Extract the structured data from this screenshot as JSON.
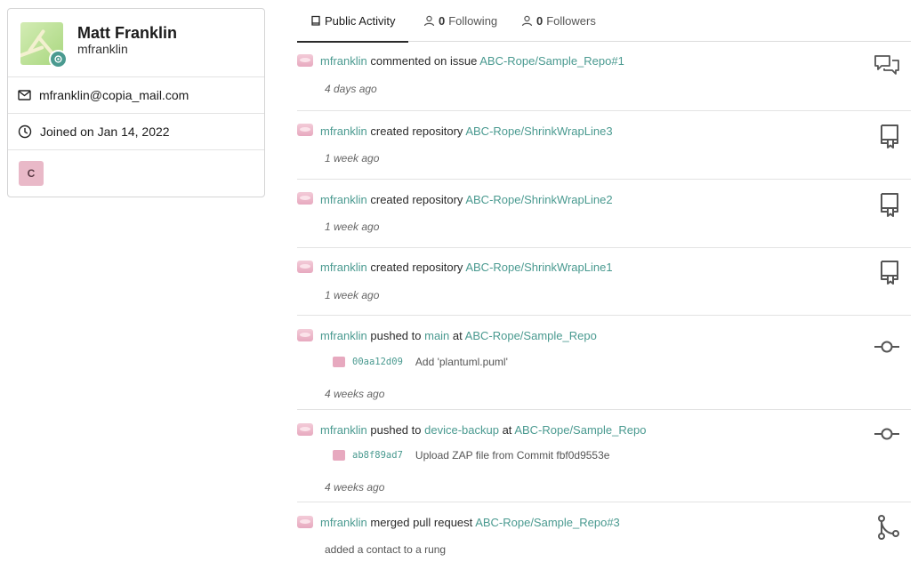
{
  "profile": {
    "full_name": "Matt Franklin",
    "username": "mfranklin",
    "email": "mfranklin@copia_mail.com",
    "joined": "Joined on Jan 14, 2022",
    "org_initial": "C",
    "icons": {
      "badge": "gear-icon",
      "email": "mail-icon",
      "joined": "clock-icon"
    }
  },
  "tabs": {
    "public_activity": "Public Activity",
    "following_count": "0",
    "following_label": "Following",
    "followers_count": "0",
    "followers_label": "Followers"
  },
  "feed": [
    {
      "user": "mfranklin",
      "action": "commented on issue",
      "target": "ABC-Rope/Sample_Repo#1",
      "time": "4 days ago",
      "icon": "comment-discussion-icon"
    },
    {
      "user": "mfranklin",
      "action": "created repository",
      "target": "ABC-Rope/ShrinkWrapLine3",
      "time": "1 week ago",
      "icon": "repo-icon"
    },
    {
      "user": "mfranklin",
      "action": "created repository",
      "target": "ABC-Rope/ShrinkWrapLine2",
      "time": "1 week ago",
      "icon": "repo-icon"
    },
    {
      "user": "mfranklin",
      "action": "created repository",
      "target": "ABC-Rope/ShrinkWrapLine1",
      "time": "1 week ago",
      "icon": "repo-icon"
    },
    {
      "user": "mfranklin",
      "action": "pushed to",
      "branch": "main",
      "at": "at",
      "target": "ABC-Rope/Sample_Repo",
      "commit_sha": "00aa12d09",
      "commit_msg": "Add 'plantuml.puml'",
      "time": "4 weeks ago",
      "icon": "git-commit-icon"
    },
    {
      "user": "mfranklin",
      "action": "pushed to",
      "branch": "device-backup",
      "at": "at",
      "target": "ABC-Rope/Sample_Repo",
      "commit_sha": "ab8f89ad7",
      "commit_msg": "Upload ZAP file from Commit fbf0d9553e",
      "time": "4 weeks ago",
      "icon": "git-commit-icon"
    },
    {
      "user": "mfranklin",
      "action": "merged pull request",
      "target": "ABC-Rope/Sample_Repo#3",
      "detail": "added a contact to a rung",
      "icon": "git-merge-icon"
    }
  ],
  "colors": {
    "link": "#4a9a90",
    "org_badge": "#e9b9c8"
  }
}
